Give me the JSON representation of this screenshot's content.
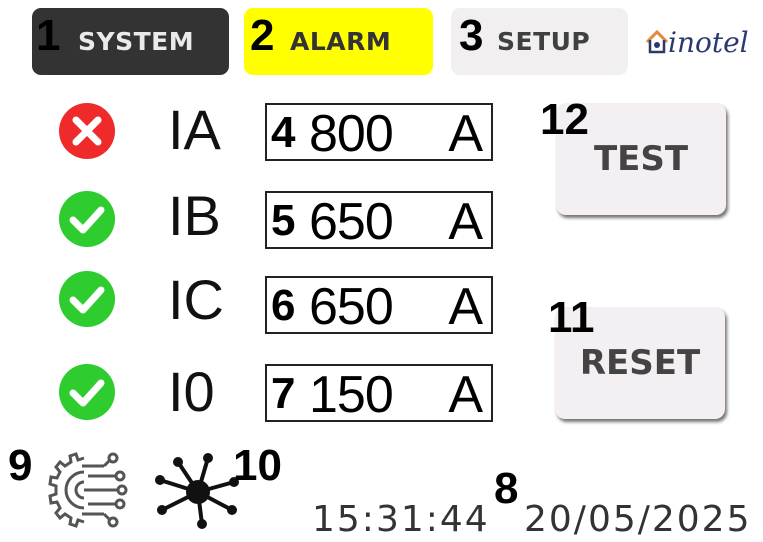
{
  "tabs": [
    {
      "number": "1",
      "label": "SYSTEM"
    },
    {
      "number": "2",
      "label": "ALARM"
    },
    {
      "number": "3",
      "label": "SETUP"
    }
  ],
  "brand": {
    "name": "inotel"
  },
  "channels": [
    {
      "label": "IA",
      "number": "4",
      "value": "800",
      "unit": "A",
      "status": "error"
    },
    {
      "label": "IB",
      "number": "5",
      "value": "650",
      "unit": "A",
      "status": "ok"
    },
    {
      "label": "IC",
      "number": "6",
      "value": "650",
      "unit": "A",
      "status": "ok"
    },
    {
      "label": "I0",
      "number": "7",
      "value": "150",
      "unit": "A",
      "status": "ok"
    }
  ],
  "buttons": {
    "test": {
      "number": "12",
      "label": "TEST"
    },
    "reset": {
      "number": "11",
      "label": "RESET"
    }
  },
  "footer": {
    "settings_number": "9",
    "network_number": "10",
    "datetime_number": "8",
    "time": "15:31:44",
    "date": "20/05/2025"
  },
  "icons": {
    "error": "x-circle-icon",
    "ok": "check-circle-icon",
    "settings": "gear-circuit-icon",
    "network": "network-hub-icon"
  },
  "colors": {
    "error": "#ee2a2a",
    "ok": "#2ecc2e",
    "alarm_tab": "#ffff00",
    "system_tab": "#333333",
    "setup_tab": "#f2eff1"
  }
}
